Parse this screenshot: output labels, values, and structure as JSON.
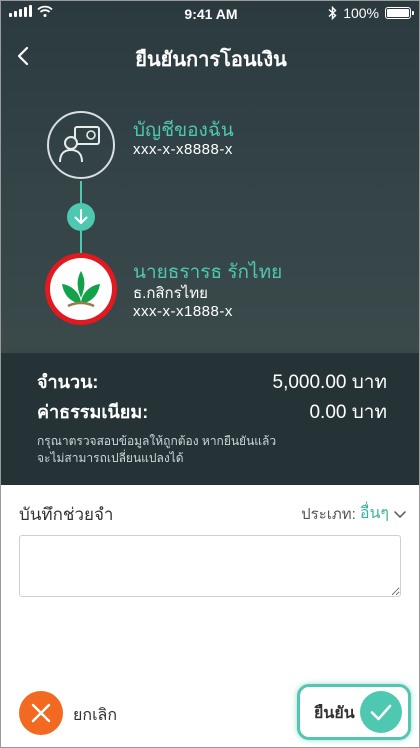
{
  "status_bar": {
    "time": "9:41 AM",
    "battery": "100%",
    "signal_icon": "signal-icon",
    "wifi_icon": "wifi-icon",
    "bluetooth_icon": "bluetooth-icon",
    "battery_icon": "battery-icon"
  },
  "nav": {
    "title": "ยืนยันการโอนเงิน",
    "back_icon": "chevron-left-icon"
  },
  "from_account": {
    "name": "บัญชีของฉัน",
    "number": "xxx-x-x8888-x",
    "icon": "account-card-icon"
  },
  "to_account": {
    "name": "นายธรารธ รักไทย",
    "bank": "ธ.กสิกรไทย",
    "number": "xxx-x-x1888-x",
    "logo": "kbank-logo"
  },
  "summary": {
    "amount_label": "จำนวน:",
    "amount_value": "5,000.00 บาท",
    "fee_label": "ค่าธรรมเนียม:",
    "fee_value": "0.00 บาท",
    "note_line1": "กรุณาตรวจสอบข้อมูลให้ถูกต้อง หากยืนยันแล้ว",
    "note_line2": "จะไม่สามารถเปลี่ยนแปลงได้"
  },
  "memo": {
    "label": "บันทึกช่วยจำ",
    "type_label": "ประเภท:",
    "type_value": "อื่นๆ",
    "placeholder": ""
  },
  "actions": {
    "cancel_label": "ยกเลิก",
    "confirm_label": "ยืนยัน"
  },
  "colors": {
    "accent": "#4ec8b0",
    "cancel": "#f26a21",
    "bank_red": "#e3191f",
    "header_bg": "#2b3a3f"
  }
}
